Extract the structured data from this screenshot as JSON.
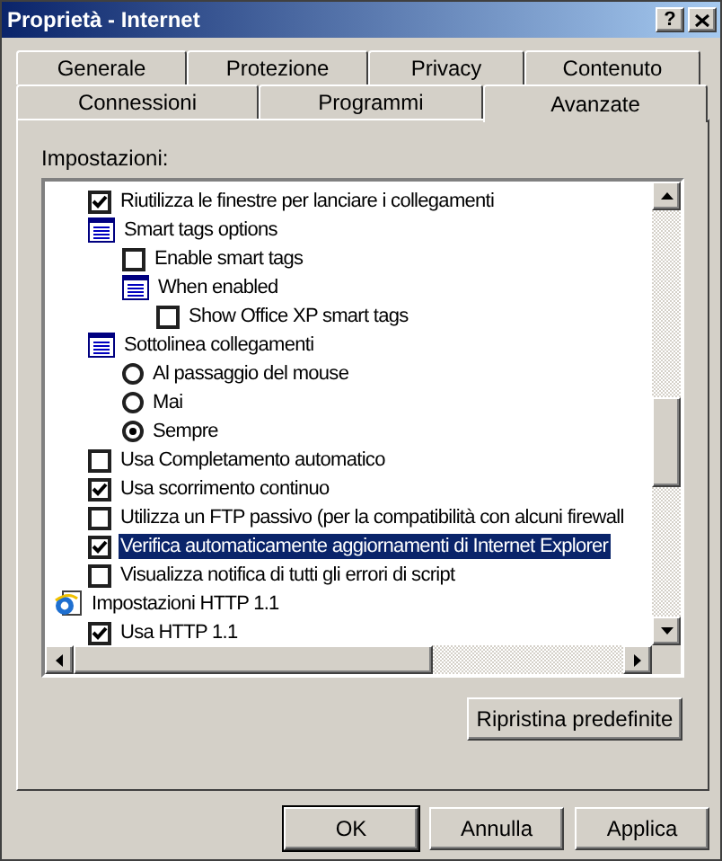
{
  "window": {
    "title": "Proprietà - Internet",
    "help": "?"
  },
  "tab_rows": [
    {
      "tabs": [
        {
          "label": "Generale",
          "selected": false
        },
        {
          "label": "Protezione",
          "selected": false
        },
        {
          "label": "Privacy",
          "selected": false
        },
        {
          "label": "Contenuto",
          "selected": false
        }
      ]
    },
    {
      "tabs": [
        {
          "label": "Connessioni",
          "selected": false
        },
        {
          "label": "Programmi",
          "selected": false
        },
        {
          "label": "Avanzate",
          "selected": true
        }
      ]
    }
  ],
  "settings_label": "Impostazioni:",
  "settings": [
    {
      "kind": "checkbox",
      "label": "Riutilizza le finestre per lanciare i collegamenti",
      "checked": true,
      "selected": false
    },
    {
      "kind": "group",
      "label": "Smart tags options",
      "selected": false,
      "children": [
        {
          "kind": "checkbox",
          "label": "Enable smart tags",
          "checked": false,
          "selected": false
        },
        {
          "kind": "group",
          "label": "When enabled",
          "selected": false,
          "children": [
            {
              "kind": "checkbox",
              "label": "Show Office XP smart tags",
              "checked": false,
              "selected": false
            }
          ]
        }
      ]
    },
    {
      "kind": "group",
      "label": "Sottolinea collegamenti",
      "selected": false,
      "children": [
        {
          "kind": "radio",
          "label": "Al passaggio del mouse",
          "checked": false,
          "selected": false
        },
        {
          "kind": "radio",
          "label": "Mai",
          "checked": false,
          "selected": false
        },
        {
          "kind": "radio",
          "label": "Sempre",
          "checked": true,
          "selected": false
        }
      ]
    },
    {
      "kind": "checkbox",
      "label": "Usa Completamento automatico",
      "checked": false,
      "selected": false
    },
    {
      "kind": "checkbox",
      "label": "Usa scorrimento continuo",
      "checked": true,
      "selected": false
    },
    {
      "kind": "checkbox",
      "label": "Utilizza un FTP passivo (per la compatibilità con alcuni firewall",
      "checked": false,
      "selected": false
    },
    {
      "kind": "checkbox",
      "label": "Verifica automaticamente aggiornamenti di Internet Explorer",
      "checked": true,
      "selected": true
    },
    {
      "kind": "checkbox",
      "label": "Visualizza notifica di tutti gli errori di script",
      "checked": false,
      "selected": false
    },
    {
      "kind": "section",
      "label": "Impostazioni HTTP 1.1",
      "selected": false,
      "children": [
        {
          "kind": "checkbox",
          "label": "Usa HTTP 1.1",
          "checked": true,
          "selected": false
        }
      ]
    }
  ],
  "restore_button": "Ripristina predefinite",
  "buttons": [
    {
      "label": "OK",
      "default": true
    },
    {
      "label": "Annulla",
      "default": false
    },
    {
      "label": "Applica",
      "default": false
    }
  ]
}
